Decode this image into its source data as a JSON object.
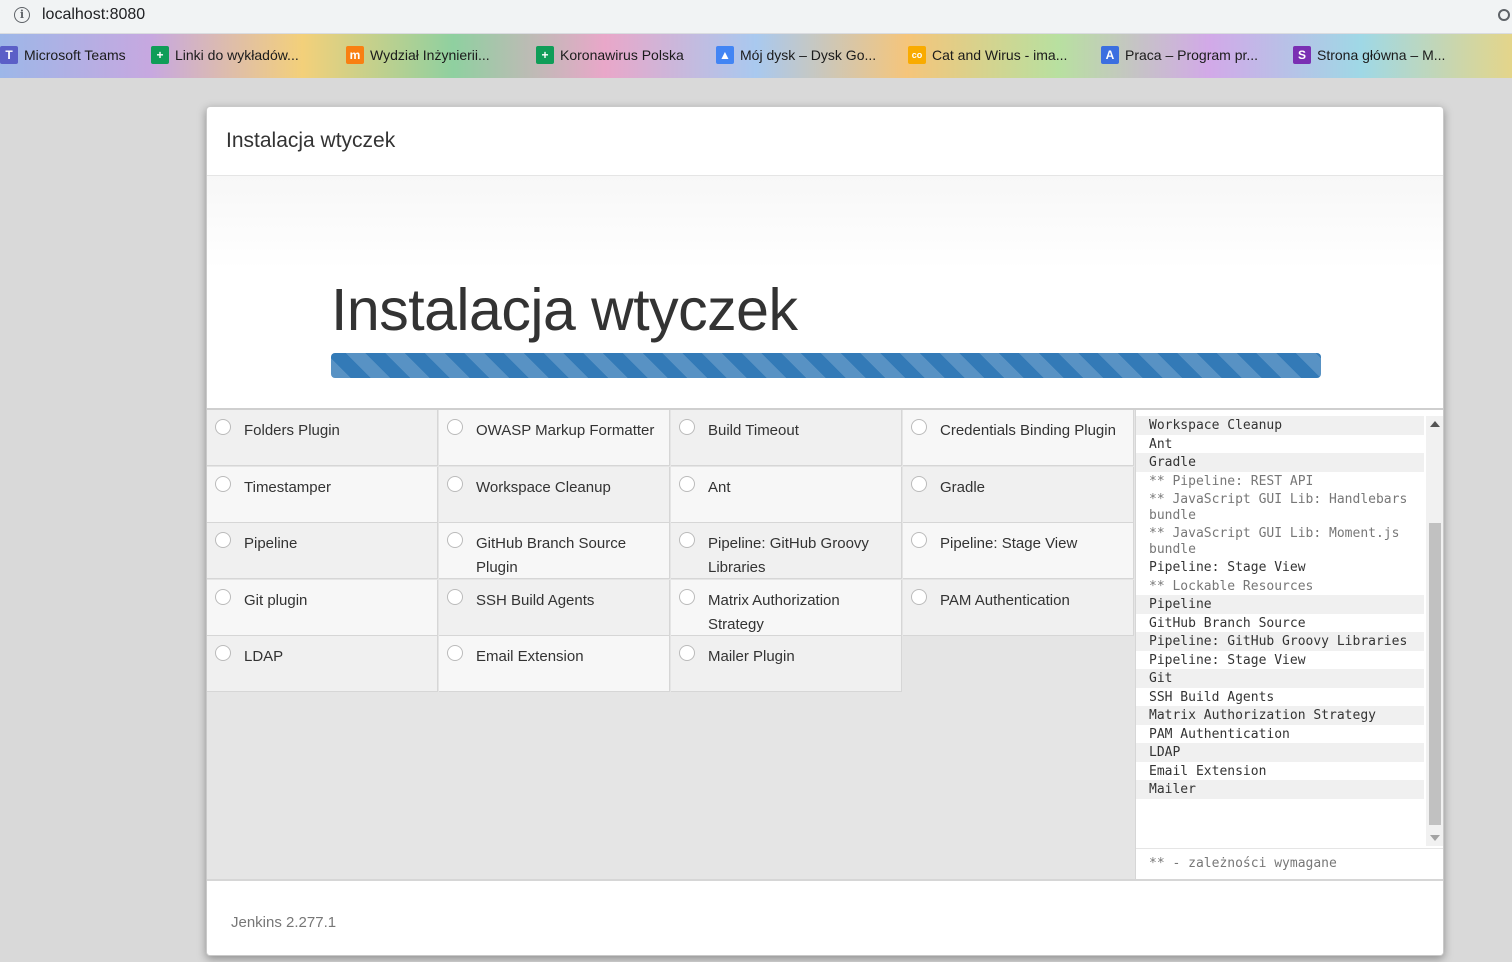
{
  "browser": {
    "url": "localhost:8080",
    "bookmarks": [
      {
        "label": "Microsoft Teams",
        "icon": "teams-icon",
        "color": "#5b5fc7"
      },
      {
        "label": "Linki do wykładów...",
        "icon": "google-sheets-icon",
        "color": "#0f9d58"
      },
      {
        "label": "Wydział Inżynierii...",
        "icon": "moodle-icon",
        "color": "#f98012"
      },
      {
        "label": "Koronawirus Polska",
        "icon": "google-sheets-icon",
        "color": "#0f9d58"
      },
      {
        "label": "Mój dysk – Dysk Go...",
        "icon": "google-drive-icon",
        "color": "#4285f4"
      },
      {
        "label": "Cat and Wirus - ima...",
        "icon": "colab-icon",
        "color": "#f9ab00"
      },
      {
        "label": "Praca – Program pr...",
        "icon": "a-letter-icon",
        "color": "#3b6fe0"
      },
      {
        "label": "Strona główna – M...",
        "icon": "sgh-icon",
        "color": "#7a2fb3"
      }
    ]
  },
  "dialog": {
    "header_title": "Instalacja wtyczek",
    "jumbotron_title": "Instalacja wtyczek",
    "progress_fraction": 1.0,
    "plugins": [
      "Folders Plugin",
      "OWASP Markup Formatter",
      "Build Timeout",
      "Credentials Binding Plugin",
      "Timestamper",
      "Workspace Cleanup",
      "Ant",
      "Gradle",
      "Pipeline",
      "GitHub Branch Source Plugin",
      "Pipeline: GitHub Groovy Libraries",
      "Pipeline: Stage View",
      "Git plugin",
      "SSH Build Agents",
      "Matrix Authorization Strategy",
      "PAM Authentication",
      "LDAP",
      "Email Extension",
      "Mailer Plugin"
    ],
    "log": [
      {
        "text": "Workspace Cleanup",
        "dep": false
      },
      {
        "text": "Ant",
        "dep": false
      },
      {
        "text": "Gradle",
        "dep": false
      },
      {
        "text": "** Pipeline: REST API",
        "dep": true
      },
      {
        "text": "** JavaScript GUI Lib: Handlebars bundle",
        "dep": true
      },
      {
        "text": "** JavaScript GUI Lib: Moment.js bundle",
        "dep": true
      },
      {
        "text": "Pipeline: Stage View",
        "dep": false
      },
      {
        "text": "** Lockable Resources",
        "dep": true
      },
      {
        "text": "Pipeline",
        "dep": false
      },
      {
        "text": "GitHub Branch Source",
        "dep": false
      },
      {
        "text": "Pipeline: GitHub Groovy Libraries",
        "dep": false
      },
      {
        "text": "Pipeline: Stage View",
        "dep": false
      },
      {
        "text": "Git",
        "dep": false
      },
      {
        "text": "SSH Build Agents",
        "dep": false
      },
      {
        "text": "Matrix Authorization Strategy",
        "dep": false
      },
      {
        "text": "PAM Authentication",
        "dep": false
      },
      {
        "text": "LDAP",
        "dep": false
      },
      {
        "text": "Email Extension",
        "dep": false
      },
      {
        "text": "Mailer",
        "dep": false
      }
    ],
    "log_footer": "** - zależności wymagane",
    "version": "Jenkins 2.277.1"
  }
}
